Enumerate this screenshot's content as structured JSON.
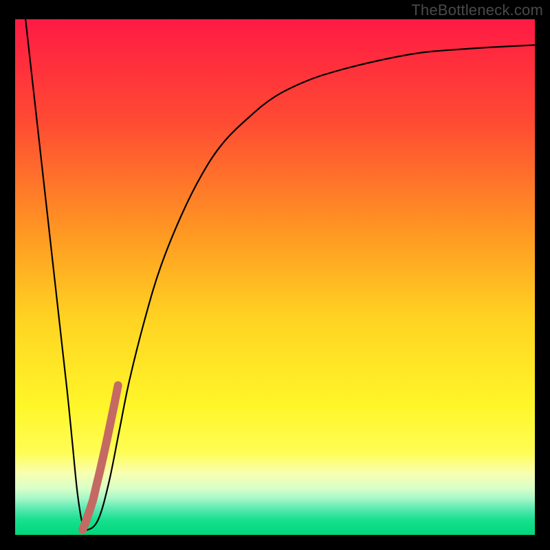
{
  "watermark": "TheBottleneck.com",
  "chart_data": {
    "type": "line",
    "title": "",
    "xlabel": "",
    "ylabel": "",
    "xlim": [
      0,
      100
    ],
    "ylim": [
      0,
      100
    ],
    "grid": false,
    "legend": false,
    "gradient_stops": [
      {
        "offset": 0,
        "color": "#ff1a44"
      },
      {
        "offset": 20,
        "color": "#ff4b33"
      },
      {
        "offset": 42,
        "color": "#ff9a22"
      },
      {
        "offset": 58,
        "color": "#ffd322"
      },
      {
        "offset": 75,
        "color": "#fff629"
      },
      {
        "offset": 84,
        "color": "#fffd55"
      },
      {
        "offset": 88,
        "color": "#f8ffb0"
      },
      {
        "offset": 91,
        "color": "#d8ffc8"
      },
      {
        "offset": 93,
        "color": "#a4f7c8"
      },
      {
        "offset": 95,
        "color": "#58e9b0"
      },
      {
        "offset": 97,
        "color": "#19e090"
      },
      {
        "offset": 100,
        "color": "#00d77a"
      }
    ],
    "series": [
      {
        "name": "bottleneck-curve",
        "stroke": "#000000",
        "stroke_width": 2.2,
        "x": [
          2,
          4,
          6,
          8,
          10,
          11,
          12,
          13,
          14,
          16,
          18,
          20,
          22,
          25,
          28,
          32,
          36,
          40,
          45,
          50,
          56,
          62,
          70,
          78,
          86,
          94,
          100
        ],
        "y": [
          100,
          82,
          64,
          46,
          28,
          18,
          8,
          2,
          1,
          3,
          10,
          20,
          30,
          42,
          52,
          62,
          70,
          76,
          81,
          85,
          88,
          90,
          92,
          93.5,
          94.2,
          94.7,
          95
        ]
      },
      {
        "name": "marker-tail",
        "type": "scatter",
        "stroke": "#c46a62",
        "fill": "#c46a62",
        "radius": 6,
        "x": [
          13.0,
          13.6,
          14.3,
          15.0,
          15.6,
          16.3,
          17.0,
          17.7,
          18.4,
          19.1,
          19.8
        ],
        "y": [
          1.0,
          2.6,
          4.6,
          6.8,
          9.4,
          12.3,
          15.4,
          18.6,
          22.0,
          25.4,
          29.0
        ]
      }
    ]
  }
}
